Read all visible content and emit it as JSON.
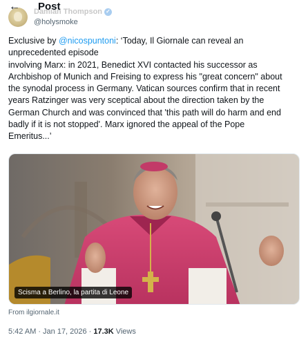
{
  "header": {
    "back_icon": "arrow-left-icon",
    "title": "Post"
  },
  "author": {
    "name": "Damian Thompson",
    "handle": "@holysmoke",
    "verified_icon": "verified-badge-icon",
    "verified_color": "#1d9bf0"
  },
  "tweet": {
    "prefix": "Exclusive by ",
    "mention": "@nicospuntoni",
    "lines": [
      ": ‘Today, Il Giornale can reveal an",
      "unprecedented episode",
      "involving Marx: in 2021, Benedict XVI contacted his successor as",
      "Archbishop of Munich and Freising to express his \"great concern\" about",
      "the synodal process in Germany. Vatican sources confirm that in recent",
      "years Ratzinger was very sceptical about the direction taken by the",
      "German Church and was convinced that 'this path will do harm and end",
      "badly if it is not stopped'. Marx ignored the appeal of the Pope",
      "Emeritus...’"
    ]
  },
  "media": {
    "caption": "Scisma a Berlino, la partita di Leone",
    "source": "From ilgiornale.it"
  },
  "meta": {
    "time": "5:42 AM",
    "separator1": "·",
    "date": "Jan 17, 2026",
    "separator2": "·",
    "views_count": "17.3K",
    "views_label": "Views"
  },
  "colors": {
    "link": "#1d9bf0",
    "text": "#0f1419",
    "secondary": "#536471"
  }
}
